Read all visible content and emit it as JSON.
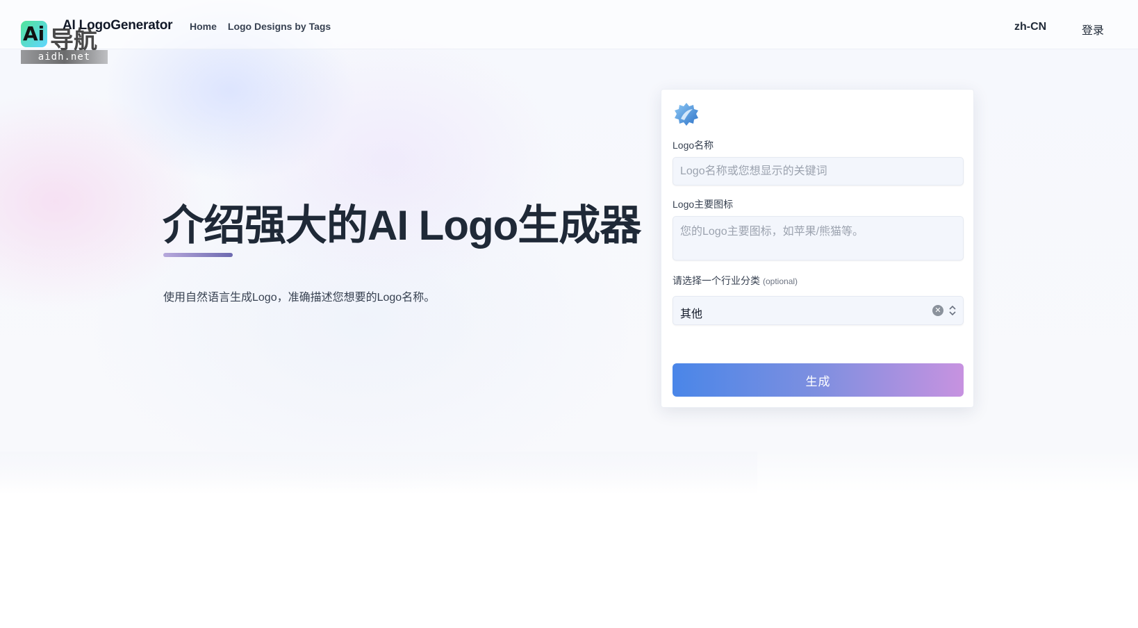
{
  "header": {
    "brand": "AI LogoGenerator",
    "nav": [
      {
        "label": "Home"
      },
      {
        "label": "Logo Designs by Tags"
      }
    ],
    "language": "zh-CN",
    "login": "登录"
  },
  "watermark": {
    "badge_text": "Ai",
    "title": "导航",
    "domain": "aidh.net"
  },
  "hero": {
    "title": "介绍强大的AI Logo生成器",
    "subtitle": "使用自然语言生成Logo，准确描述您想要的Logo名称。"
  },
  "form": {
    "icon": "gear-icon",
    "name_label": "Logo名称",
    "name_placeholder": "Logo名称或您想显示的关键词",
    "name_value": "",
    "icon_label": "Logo主要图标",
    "icon_placeholder": "您的Logo主要图标，如苹果/熊猫等。",
    "icon_value": "",
    "industry_label": "请选择一个行业分类",
    "industry_optional": "(optional)",
    "industry_value": "其他",
    "submit_label": "生成"
  },
  "colors": {
    "button_start": "#4a86e8",
    "button_end": "#c792e0",
    "text_primary": "#1f2937"
  }
}
